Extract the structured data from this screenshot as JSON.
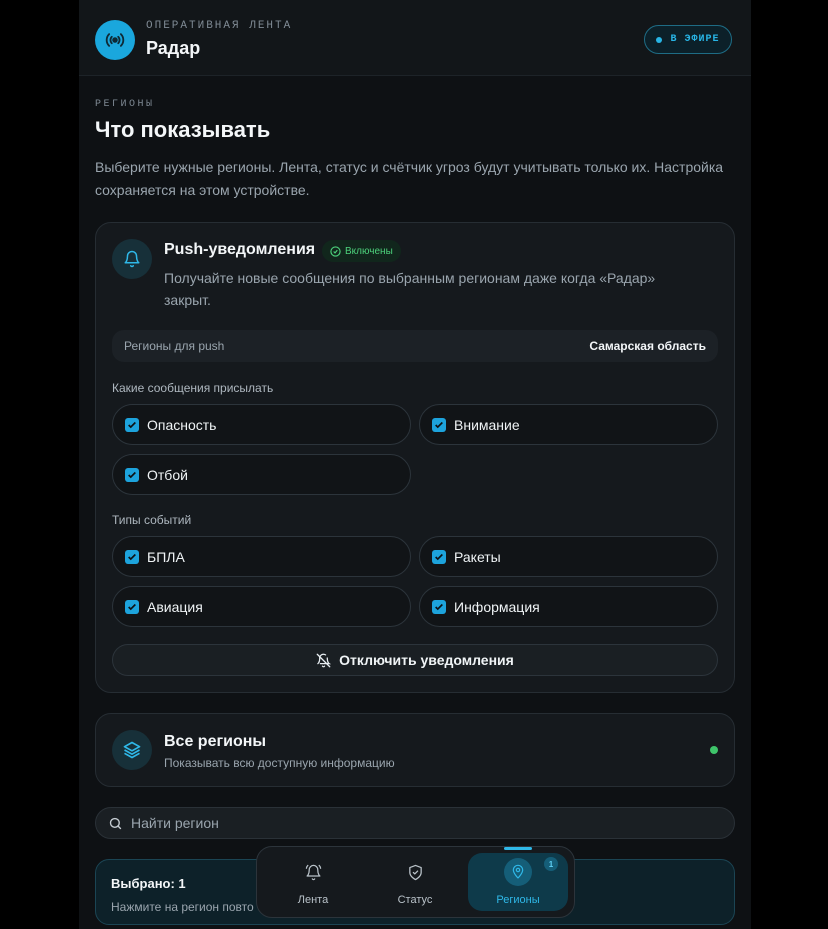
{
  "header": {
    "eyebrow": "ОПЕРАТИВНАЯ ЛЕНТА",
    "title": "Радар",
    "live_label": "В ЭФИРЕ"
  },
  "page": {
    "section_label": "РЕГИОНЫ",
    "title": "Что показывать",
    "description": "Выберите нужные регионы. Лента, статус и счётчик угроз будут учитывать только их. Настройка сохраняется на этом устройстве."
  },
  "push": {
    "title": "Push-уведомления",
    "status_badge": "Включены",
    "description": "Получайте новые сообщения по выбранным регионам даже когда «Радар» закрыт.",
    "regions_label": "Регионы для push",
    "regions_value": "Самарская область",
    "messages_group_label": "Какие сообщения присылать",
    "message_options": [
      {
        "label": "Опасность",
        "checked": true
      },
      {
        "label": "Внимание",
        "checked": true
      },
      {
        "label": "Отбой",
        "checked": true
      }
    ],
    "events_group_label": "Типы событий",
    "event_options": [
      {
        "label": "БПЛА",
        "checked": true
      },
      {
        "label": "Ракеты",
        "checked": true
      },
      {
        "label": "Авиация",
        "checked": true
      },
      {
        "label": "Информация",
        "checked": true
      }
    ],
    "disable_button": "Отключить уведомления"
  },
  "all_regions": {
    "title": "Все регионы",
    "subtitle": "Показывать всю доступную информацию"
  },
  "search": {
    "placeholder": "Найти регион"
  },
  "selected": {
    "title": "Выбрано: 1",
    "hint": "Нажмите на регион повто"
  },
  "nav": {
    "items": [
      {
        "label": "Лента",
        "icon": "bell-ring-icon"
      },
      {
        "label": "Статус",
        "icon": "shield-check-icon"
      },
      {
        "label": "Регионы",
        "icon": "map-pin-user-icon",
        "active": true,
        "badge": "1"
      }
    ]
  },
  "colors": {
    "accent": "#1aa7dd",
    "success": "#3ec46a",
    "background": "#0e1114",
    "card": "#15191d"
  }
}
